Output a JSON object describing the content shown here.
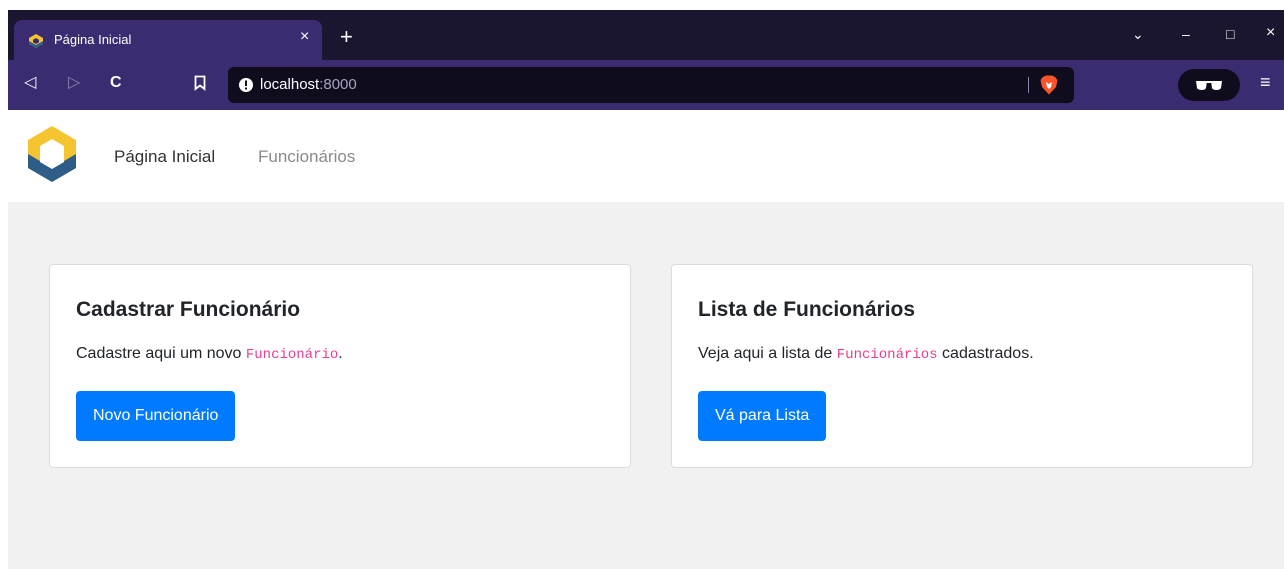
{
  "browser": {
    "tab": {
      "title": "Página Inicial",
      "close_icon": "×"
    },
    "new_tab_icon": "+",
    "window_controls": {
      "dropdown": "⌄",
      "minimize": "–",
      "maximize": "□",
      "close": "×"
    },
    "toolbar": {
      "back_icon": "◁",
      "forward_icon": "▷",
      "reload_icon": "C",
      "bookmark_icon": "bookmark-icon",
      "url_host": "localhost",
      "url_port": ":8000",
      "menu_icon": "≡"
    }
  },
  "navbar": {
    "links": [
      {
        "label": "Página Inicial"
      },
      {
        "label": "Funcionários"
      }
    ]
  },
  "cards": [
    {
      "title": "Cadastrar Funcionário",
      "text_before": "Cadastre aqui um novo ",
      "code": "Funcionário",
      "text_after": ".",
      "button": "Novo Funcionário"
    },
    {
      "title": "Lista de Funcionários",
      "text_before": "Veja aqui a lista de ",
      "code": "Funcionários",
      "text_after": " cadastrados.",
      "button": "Vá para Lista"
    }
  ],
  "colors": {
    "tabstrip": "#1b1630",
    "toolbar": "#3b2b70",
    "primary_button": "#007bff",
    "code_pink": "#e83e8c",
    "page_bg": "#f1f1f1"
  }
}
